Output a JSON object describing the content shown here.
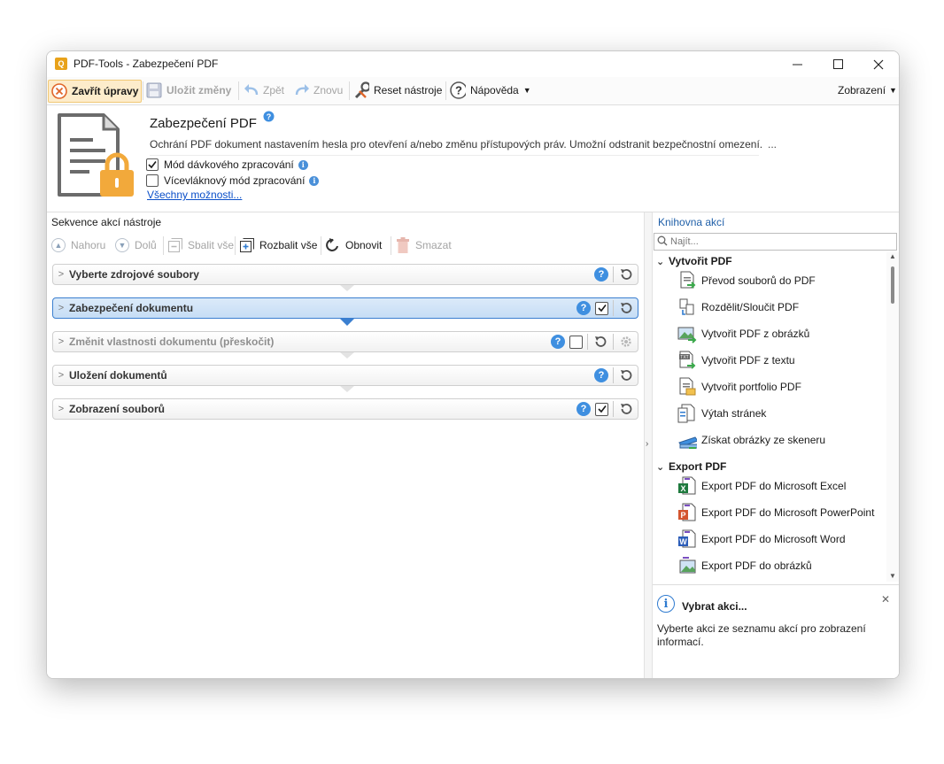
{
  "window": {
    "title": "PDF-Tools - Zabezpečení PDF"
  },
  "toolbar": {
    "close_edits": "Zavřít úpravy",
    "save_changes": "Uložit změny",
    "undo": "Zpět",
    "redo": "Znovu",
    "reset_tool": "Reset nástroje",
    "help": "Nápověda",
    "view": "Zobrazení"
  },
  "header": {
    "title": "Zabezpečení PDF",
    "description": "Ochrání PDF dokument nastavením hesla pro otevření a/nebo změnu přístupových práv. Umožní odstranit bezpečnostní omezení.",
    "more": "...",
    "batch_mode": {
      "label": "Mód dávkového zpracování",
      "checked": true
    },
    "multithread_mode": {
      "label": "Vícevláknový mód zpracování",
      "checked": false
    },
    "all_options_link": "Všechny možnosti..."
  },
  "sequence": {
    "title": "Sekvence akcí nástroje",
    "toolbar": {
      "up": "Nahoru",
      "down": "Dolů",
      "collapse_all": "Sbalit vše",
      "expand_all": "Rozbalit vše",
      "refresh": "Obnovit",
      "delete": "Smazat"
    },
    "steps": [
      {
        "label": "Vyberte zdrojové soubory",
        "selected": false,
        "skipped": false,
        "has_checkbox": false,
        "checked": false
      },
      {
        "label": "Zabezpečení dokumentu",
        "selected": true,
        "skipped": false,
        "has_checkbox": true,
        "checked": true
      },
      {
        "label": "Změnit vlastnosti dokumentu (přeskočit)",
        "selected": false,
        "skipped": true,
        "has_checkbox": true,
        "checked": false
      },
      {
        "label": "Uložení dokumentů",
        "selected": false,
        "skipped": false,
        "has_checkbox": false,
        "checked": false
      },
      {
        "label": "Zobrazení souborů",
        "selected": false,
        "skipped": false,
        "has_checkbox": true,
        "checked": true
      }
    ]
  },
  "library": {
    "title": "Knihovna akcí",
    "search_placeholder": "Najít...",
    "groups": [
      {
        "name": "Vytvořit PDF",
        "items": [
          {
            "label": "Převod souborů do PDF",
            "icon": "convert-files-icon"
          },
          {
            "label": "Rozdělit/Sloučit PDF",
            "icon": "split-merge-icon"
          },
          {
            "label": "Vytvořit PDF z obrázků",
            "icon": "pdf-from-images-icon"
          },
          {
            "label": "Vytvořit PDF z textu",
            "icon": "pdf-from-text-icon"
          },
          {
            "label": "Vytvořit portfolio PDF",
            "icon": "pdf-portfolio-icon"
          },
          {
            "label": "Výtah stránek",
            "icon": "extract-pages-icon"
          },
          {
            "label": "Získat obrázky ze skeneru",
            "icon": "scanner-icon"
          }
        ]
      },
      {
        "name": "Export PDF",
        "items": [
          {
            "label": "Export PDF do Microsoft Excel",
            "icon": "excel-icon"
          },
          {
            "label": "Export PDF do Microsoft PowerPoint",
            "icon": "powerpoint-icon"
          },
          {
            "label": "Export PDF do Microsoft Word",
            "icon": "word-icon"
          },
          {
            "label": "Export PDF do obrázků",
            "icon": "image-export-icon"
          }
        ]
      }
    ]
  },
  "info_panel": {
    "title": "Vybrat akci...",
    "text": "Vyberte akci ze seznamu akcí pro zobrazení informací."
  },
  "colors": {
    "accent_blue": "#3b7fd0",
    "selected_step_bg": "#c6ddf5",
    "active_button_bg": "#fdeccb",
    "lock_orange": "#f2a93b",
    "link_blue": "#0a4fc9"
  }
}
